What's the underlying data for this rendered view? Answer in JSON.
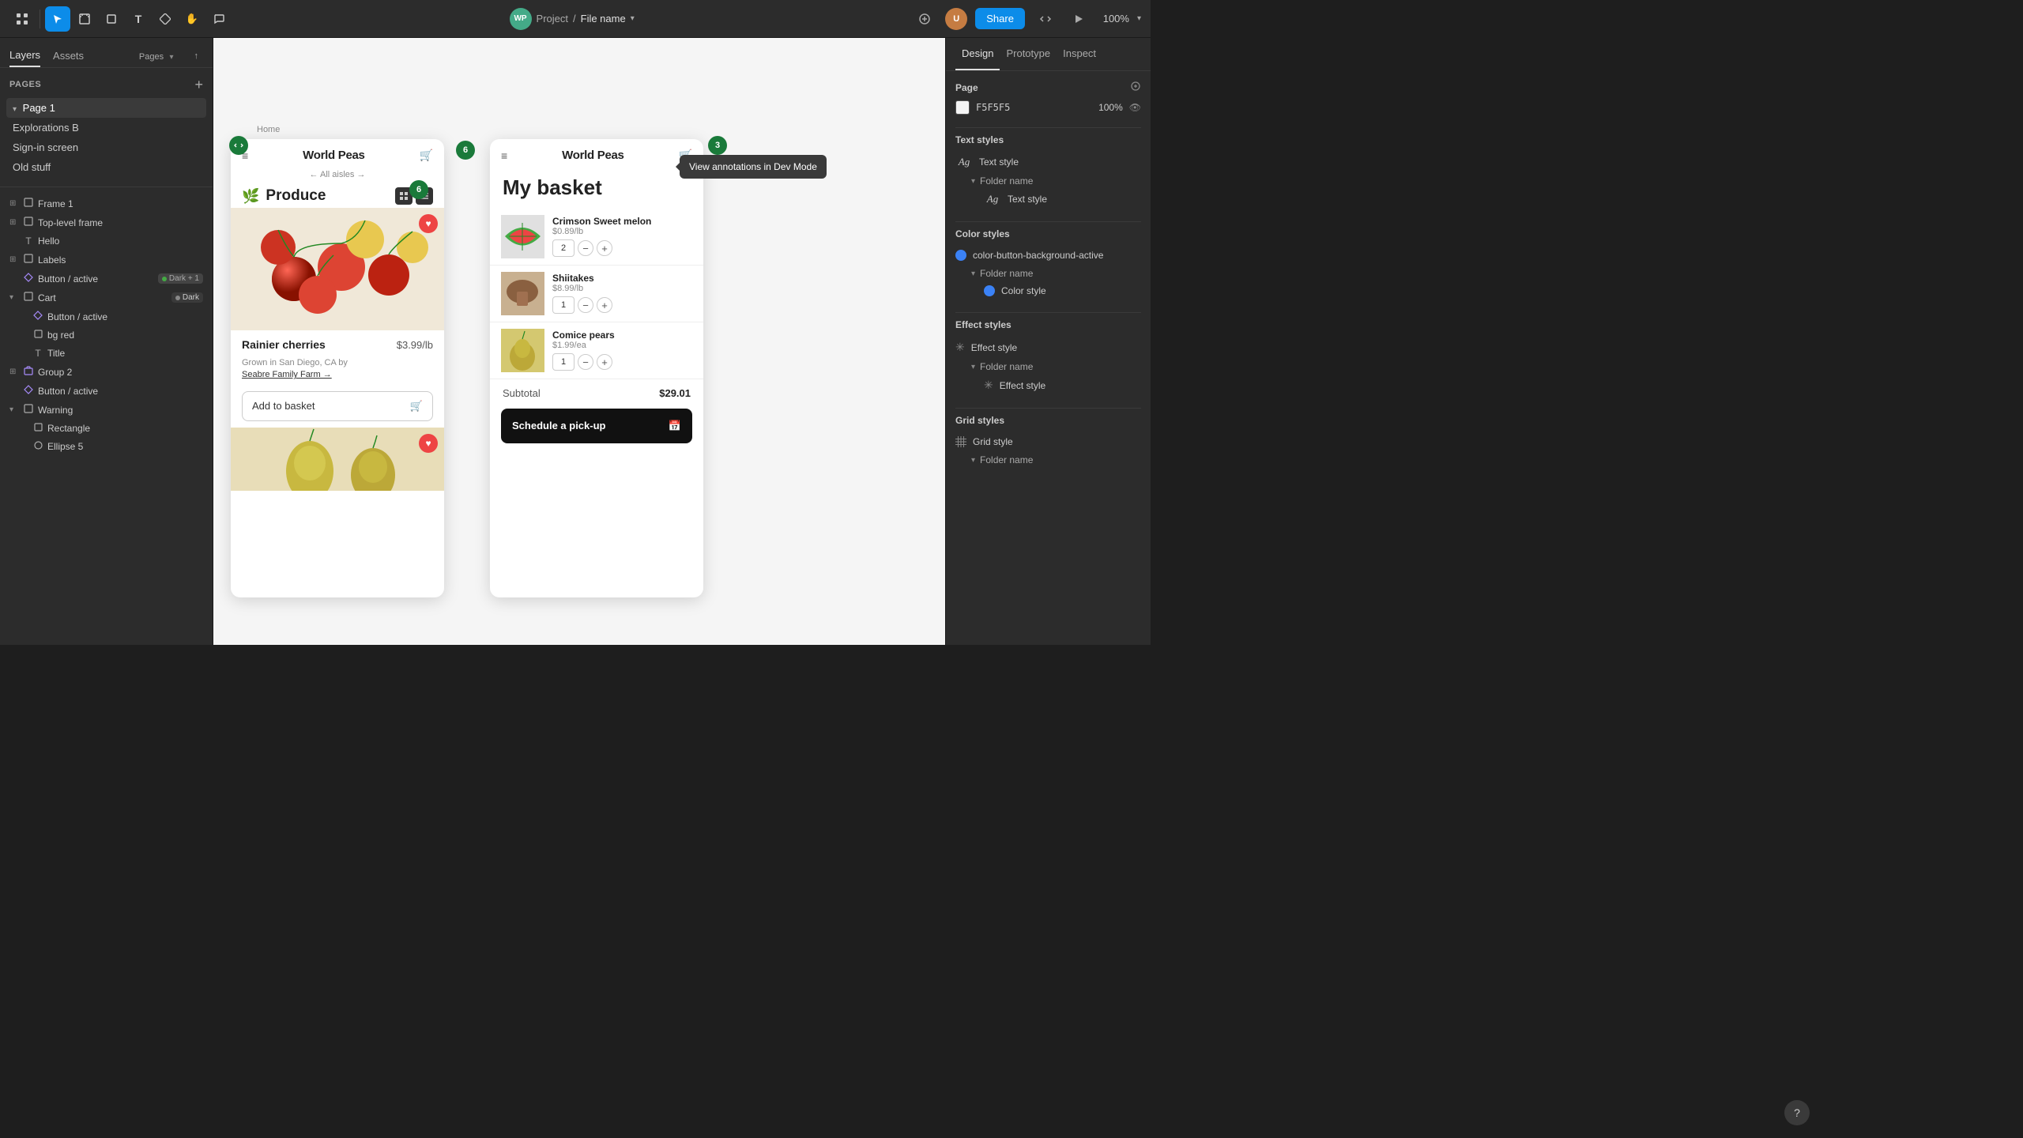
{
  "topbar": {
    "project": "Project",
    "separator": "/",
    "filename": "File name",
    "share_label": "Share",
    "zoom": "100%",
    "tools": [
      {
        "name": "grid-tool",
        "icon": "⊞",
        "label": "Grid"
      },
      {
        "name": "select-tool",
        "icon": "↖",
        "label": "Select",
        "active": true
      },
      {
        "name": "frame-tool",
        "icon": "⊡",
        "label": "Frame"
      },
      {
        "name": "shape-tool",
        "icon": "◇",
        "label": "Shape"
      },
      {
        "name": "text-tool",
        "icon": "T",
        "label": "Text"
      },
      {
        "name": "component-tool",
        "icon": "⧉",
        "label": "Component"
      },
      {
        "name": "hand-tool",
        "icon": "✋",
        "label": "Hand"
      },
      {
        "name": "comment-tool",
        "icon": "💬",
        "label": "Comment"
      }
    ]
  },
  "left_panel": {
    "tabs": [
      {
        "name": "layers-tab",
        "label": "Layers",
        "active": true
      },
      {
        "name": "assets-tab",
        "label": "Assets",
        "active": false
      }
    ],
    "page_header": {
      "title": "Pages",
      "add_label": "+"
    },
    "pages": [
      {
        "name": "page-1",
        "label": "Page 1",
        "active": true,
        "expanded": true
      },
      {
        "name": "explorations-b",
        "label": "Explorations B",
        "active": false
      },
      {
        "name": "sign-in-screen",
        "label": "Sign-in screen",
        "active": false
      },
      {
        "name": "old-stuff",
        "label": "Old stuff",
        "active": false
      }
    ],
    "layers": [
      {
        "id": "frame-1",
        "name": "Frame 1",
        "icon": "frame",
        "indent": 0,
        "expand": true
      },
      {
        "id": "top-level-frame",
        "name": "Top-level frame",
        "icon": "frame",
        "indent": 0,
        "expand": true
      },
      {
        "id": "hello",
        "name": "Hello",
        "icon": "text",
        "indent": 0,
        "expand": false
      },
      {
        "id": "labels",
        "name": "Labels",
        "icon": "frame",
        "indent": 0,
        "expand": true
      },
      {
        "id": "button-active",
        "name": "Button / active",
        "icon": "component",
        "indent": 0,
        "expand": false,
        "badge": "Dark + 1"
      },
      {
        "id": "cart",
        "name": "Cart",
        "icon": "frame",
        "indent": 0,
        "expand": true,
        "badge": "Dark"
      },
      {
        "id": "button-active-2",
        "name": "Button / active",
        "icon": "component",
        "indent": 1,
        "expand": false
      },
      {
        "id": "bg-red",
        "name": "bg red",
        "icon": "rect",
        "indent": 1,
        "expand": false
      },
      {
        "id": "title",
        "name": "Title",
        "icon": "text",
        "indent": 1,
        "expand": false
      },
      {
        "id": "group-2",
        "name": "Group 2",
        "icon": "group",
        "indent": 0,
        "expand": true
      },
      {
        "id": "button-active-3",
        "name": "Button / active",
        "icon": "component",
        "indent": 0,
        "expand": false
      },
      {
        "id": "warning",
        "name": "Warning",
        "icon": "frame",
        "indent": 0,
        "expand": true
      },
      {
        "id": "rectangle",
        "name": "Rectangle",
        "icon": "rect",
        "indent": 1,
        "expand": false
      },
      {
        "id": "ellipse-5",
        "name": "Ellipse 5",
        "icon": "ellipse",
        "indent": 1,
        "expand": false
      }
    ]
  },
  "canvas": {
    "home_label": "Home",
    "phone1": {
      "title": "World Peas",
      "nav": "← All aisles →",
      "section_icon": "🌿",
      "section_title": "Produce",
      "product_name": "Rainier cherries",
      "product_price": "$3.99/lb",
      "product_desc": "Grown in San Diego, CA by",
      "product_link": "Seabre Family Farm →",
      "add_btn": "Add to basket",
      "ann_badge_6a": "6",
      "ann_badge_6b": "6"
    },
    "phone2": {
      "title": "World Peas",
      "basket_title": "My basket",
      "items": [
        {
          "name": "Crimson Sweet melon",
          "price": "$0.89/lb",
          "qty": "2"
        },
        {
          "name": "Shiitakes",
          "price": "$8.99/lb",
          "qty": "1"
        },
        {
          "name": "Comice pears",
          "price": "$1.99/ea",
          "qty": "1"
        }
      ],
      "subtotal_label": "Subtotal",
      "subtotal_amount": "$29.01",
      "pickup_btn": "Schedule a pick-up",
      "ann_badge_3": "3"
    },
    "tooltip": "View annotations in Dev Mode"
  },
  "right_panel": {
    "tabs": [
      {
        "name": "design-tab",
        "label": "Design",
        "active": true
      },
      {
        "name": "prototype-tab",
        "label": "Prototype",
        "active": false
      },
      {
        "name": "inspect-tab",
        "label": "Inspect",
        "active": false
      }
    ],
    "page_section": {
      "title": "Page",
      "color_hex": "F5F5F5",
      "opacity": "100%"
    },
    "text_styles": {
      "title": "Text styles",
      "items": [
        {
          "name": "text-style-1",
          "label": "Text style",
          "prefix": "Ag"
        },
        {
          "name": "folder-name-1",
          "label": "Folder name"
        },
        {
          "name": "text-style-2",
          "label": "Text style",
          "prefix": "Ag"
        }
      ]
    },
    "color_styles": {
      "title": "Color styles",
      "items": [
        {
          "name": "color-button-bg-active",
          "label": "color-button-background-active",
          "color": "#3b82f6"
        },
        {
          "name": "folder-name-2",
          "label": "Folder name"
        },
        {
          "name": "color-style-1",
          "label": "Color style",
          "color": "#3b82f6"
        }
      ]
    },
    "effect_styles": {
      "title": "Effect styles",
      "items": [
        {
          "name": "effect-style-1",
          "label": "Effect style"
        },
        {
          "name": "folder-name-3",
          "label": "Folder name"
        },
        {
          "name": "effect-style-2",
          "label": "Effect style"
        }
      ]
    },
    "grid_styles": {
      "title": "Grid styles",
      "items": [
        {
          "name": "grid-style-1",
          "label": "Grid style"
        },
        {
          "name": "folder-name-4",
          "label": "Folder name"
        }
      ]
    }
  }
}
